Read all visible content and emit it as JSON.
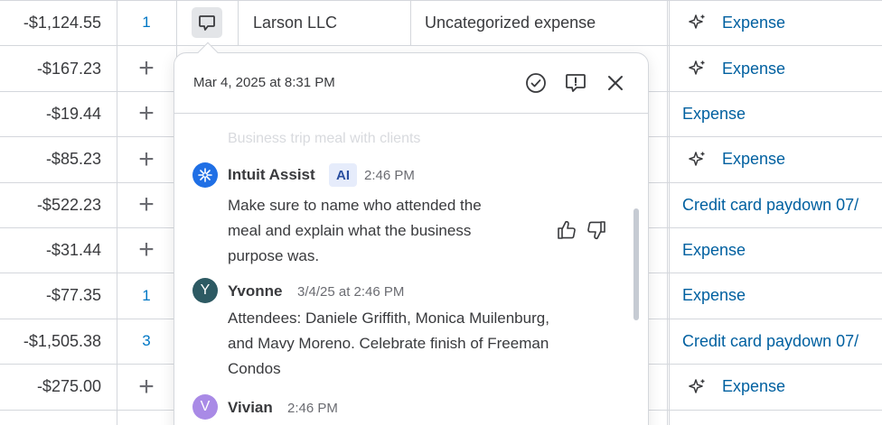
{
  "rows": [
    {
      "amount": "-$1,124.55",
      "count": "1",
      "type": "Expense",
      "type_icon": "sparkle-icon"
    },
    {
      "amount": "-$167.23",
      "count": "+",
      "type": "Expense",
      "type_icon": "sparkle-icon"
    },
    {
      "amount": "-$19.44",
      "count": "+",
      "type": "Expense",
      "type_icon": ""
    },
    {
      "amount": "-$85.23",
      "count": "+",
      "type": "Expense",
      "type_icon": "sparkle-icon"
    },
    {
      "amount": "-$522.23",
      "count": "+",
      "type": "Credit card paydown 07/",
      "type_icon": ""
    },
    {
      "amount": "-$31.44",
      "count": "+",
      "type": "Expense",
      "type_icon": ""
    },
    {
      "amount": "-$77.35",
      "count": "1",
      "type": "Expense",
      "type_icon": ""
    },
    {
      "amount": "-$1,505.38",
      "count": "3",
      "type": "Credit card paydown 07/",
      "type_icon": ""
    },
    {
      "amount": "-$275.00",
      "count": "+",
      "type": "Expense",
      "type_icon": "sparkle-icon"
    }
  ],
  "first_row": {
    "payee": "Larson LLC",
    "category": "Uncategorized expense"
  },
  "popover": {
    "date": "Mar 4, 2025 at 8:31 PM",
    "faded_text": "Business trip meal with clients",
    "messages": [
      {
        "name": "Intuit Assist",
        "badge": "AI",
        "time": "2:46 PM",
        "avatar": "",
        "lines": [
          "Make sure to name who attended the",
          "meal and explain what the business",
          "purpose was."
        ]
      },
      {
        "name": "Yvonne",
        "time": "3/4/25 at 2:46 PM",
        "avatar": "Y",
        "lines": [
          "Attendees: Daniele Griffith, Monica Muilenburg,",
          "and Mavy Moreno. Celebrate finish of Freeman",
          "Condos"
        ]
      },
      {
        "name": "Vivian",
        "time": "2:46 PM",
        "avatar": "V",
        "lines": []
      }
    ]
  },
  "colors": {
    "link": "#0060a0",
    "accent_blue": "#0077c5",
    "yvonne_avatar": "#2d5a63",
    "vivian_avatar": "#a98ae6",
    "assist_avatar": "#1f6fe5"
  }
}
